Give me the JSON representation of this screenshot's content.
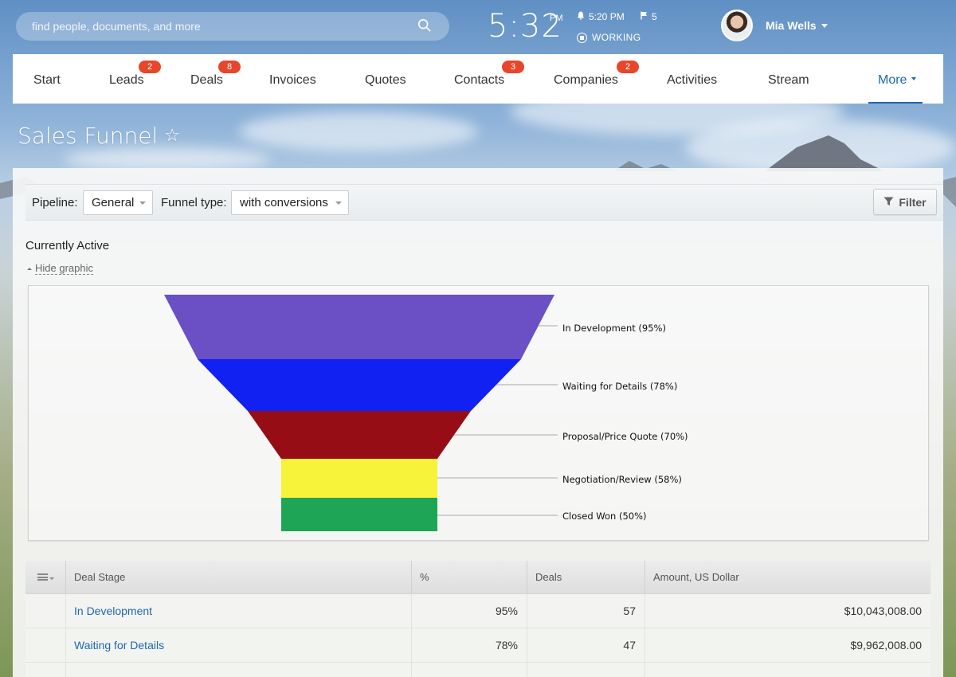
{
  "header": {
    "search_placeholder": "find people, documents, and more",
    "clock": "5:32",
    "ampm": "PM",
    "alarm_time": "5:20 PM",
    "flag_count": "5",
    "work_status": "WORKING",
    "user_name": "Mia Wells"
  },
  "nav": {
    "items": [
      {
        "label": "Start",
        "badge": ""
      },
      {
        "label": "Leads",
        "badge": "2"
      },
      {
        "label": "Deals",
        "badge": "8"
      },
      {
        "label": "Invoices",
        "badge": ""
      },
      {
        "label": "Quotes",
        "badge": ""
      },
      {
        "label": "Contacts",
        "badge": "3"
      },
      {
        "label": "Companies",
        "badge": "2"
      },
      {
        "label": "Activities",
        "badge": ""
      },
      {
        "label": "Stream",
        "badge": ""
      },
      {
        "label": "More",
        "badge": ""
      }
    ]
  },
  "page": {
    "title": "Sales Funnel",
    "star": "☆"
  },
  "filters": {
    "pipeline_label": "Pipeline:",
    "pipeline_value": "General",
    "funnel_type_label": "Funnel type:",
    "funnel_type_value": "with conversions",
    "filter_button": "Filter"
  },
  "section": {
    "title": "Currently Active",
    "hide_graphic": "Hide graphic"
  },
  "chart_data": {
    "type": "funnel",
    "stages": [
      {
        "label": "In Development (95%)",
        "value": 95,
        "color": "#6a50c4"
      },
      {
        "label": "Waiting for Details (78%)",
        "value": 78,
        "color": "#1121f2"
      },
      {
        "label": "Proposal/Price Quote (70%)",
        "value": 70,
        "color": "#960d16"
      },
      {
        "label": "Negotiation/Review (58%)",
        "value": 58,
        "color": "#f7f23a"
      },
      {
        "label": "Closed Won (50%)",
        "value": 50,
        "color": "#1ea656"
      }
    ]
  },
  "table": {
    "columns": [
      "Deal Stage",
      "%",
      "Deals",
      "Amount, US Dollar"
    ],
    "rows": [
      {
        "stage": "In Development",
        "percent": "95%",
        "deals": "57",
        "amount": "$10,043,008.00"
      },
      {
        "stage": "Waiting for Details",
        "percent": "78%",
        "deals": "47",
        "amount": "$9,962,008.00"
      }
    ]
  },
  "colors": {
    "accent": "#2067b0",
    "badge": "#e8462b"
  }
}
